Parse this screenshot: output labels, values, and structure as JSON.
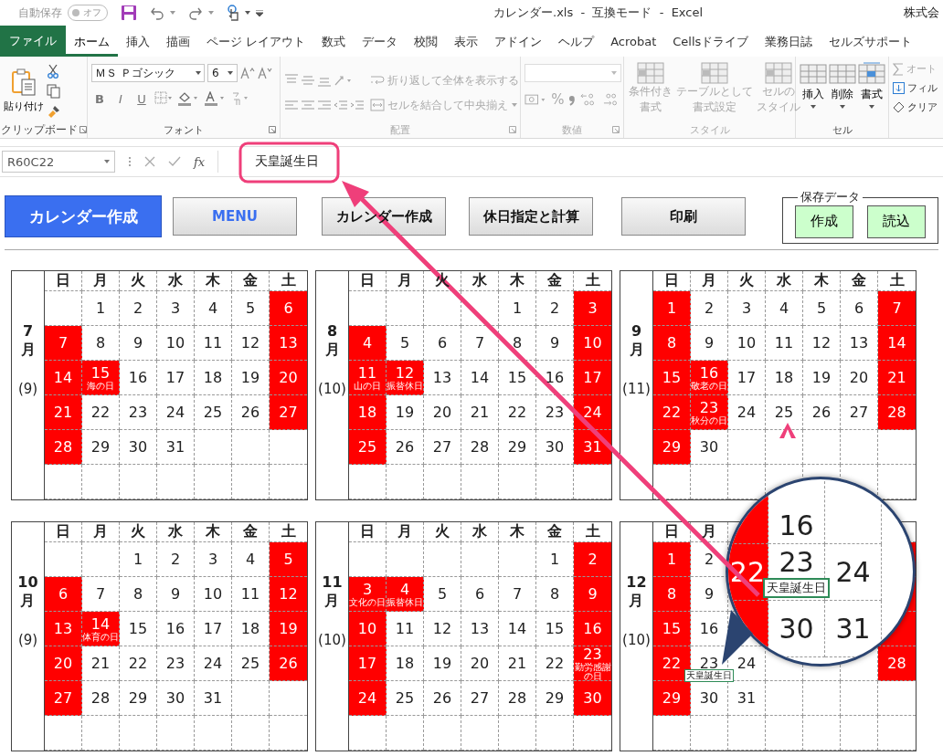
{
  "title_bar": {
    "autosave_label": "自動保存",
    "autosave_state": "オフ",
    "autosave_on": false,
    "title": "カレンダー.xls  -  互換モード  -  Excel",
    "account": "株式会"
  },
  "file_tab": "ファイル",
  "tabs": [
    {
      "label": "ホーム",
      "selected": true
    },
    {
      "label": "挿入",
      "selected": false
    },
    {
      "label": "描画",
      "selected": false
    },
    {
      "label": "ページ レイアウト",
      "selected": false
    },
    {
      "label": "数式",
      "selected": false
    },
    {
      "label": "データ",
      "selected": false
    },
    {
      "label": "校閲",
      "selected": false
    },
    {
      "label": "表示",
      "selected": false
    },
    {
      "label": "アドイン",
      "selected": false
    },
    {
      "label": "ヘルプ",
      "selected": false
    },
    {
      "label": "Acrobat",
      "selected": false
    },
    {
      "label": "Cellsドライブ",
      "selected": false
    },
    {
      "label": "業務日誌",
      "selected": false
    },
    {
      "label": "セルズサポート",
      "selected": false
    }
  ],
  "ribbon": {
    "clipboard": {
      "paste": "貼り付け",
      "label": "クリップボード"
    },
    "font": {
      "name": "ＭＳ Ｐゴシック",
      "size": "6",
      "styles": [
        "B",
        "I",
        "U"
      ],
      "label": "フォント"
    },
    "alignment": {
      "wrap": "折り返して全体を表示する",
      "merge": "セルを結合して中央揃え",
      "label": "配置",
      "disabled": true
    },
    "number": {
      "percent": "%",
      "label": "数値",
      "disabled": true
    },
    "styles": {
      "buttons": [
        {
          "lines": [
            "条件付き",
            "書式"
          ]
        },
        {
          "lines": [
            "テーブルとして",
            "書式設定"
          ]
        },
        {
          "lines": [
            "セルの",
            "スタイル"
          ]
        }
      ],
      "label": "スタイル",
      "disabled": true
    },
    "cells": {
      "buttons": [
        "挿入",
        "削除",
        "書式"
      ],
      "label": "セル"
    },
    "editing": {
      "items": [
        "オート",
        "フィル",
        "クリア"
      ]
    }
  },
  "formula_bar": {
    "name_box": "R60C22",
    "fx": "fx",
    "value": "天皇誕生日"
  },
  "buttons": [
    {
      "label": "カレンダー作成",
      "kind": "primary"
    },
    {
      "label": "MENU",
      "kind": "menu"
    },
    {
      "label": "カレンダー作成",
      "kind": "plain"
    },
    {
      "label": "休日指定と計算",
      "kind": "plain"
    },
    {
      "label": "印刷",
      "kind": "plain"
    }
  ],
  "saved_data": {
    "title": "保存データ",
    "buttons": [
      "作成",
      "読込"
    ]
  },
  "calendars": [
    {
      "month": "7",
      "unit": "月",
      "count": "(9)",
      "weekdays": [
        "日",
        "月",
        "火",
        "水",
        "木",
        "金",
        "土"
      ],
      "weeks": [
        [
          {
            "red": false
          },
          {
            "day": "1",
            "red": false
          },
          {
            "day": "2",
            "red": false
          },
          {
            "day": "3",
            "red": false
          },
          {
            "day": "4",
            "red": false
          },
          {
            "day": "5",
            "red": false
          },
          {
            "day": "6",
            "red": true
          }
        ],
        [
          {
            "day": "7",
            "red": true
          },
          {
            "day": "8",
            "red": false
          },
          {
            "day": "9",
            "red": false
          },
          {
            "day": "10",
            "red": false
          },
          {
            "day": "11",
            "red": false
          },
          {
            "day": "12",
            "red": false
          },
          {
            "day": "13",
            "red": true
          }
        ],
        [
          {
            "day": "14",
            "red": true
          },
          {
            "day": "15",
            "red": true,
            "label": "海の日"
          },
          {
            "day": "16",
            "red": false
          },
          {
            "day": "17",
            "red": false
          },
          {
            "day": "18",
            "red": false
          },
          {
            "day": "19",
            "red": false
          },
          {
            "day": "20",
            "red": true
          }
        ],
        [
          {
            "day": "21",
            "red": true
          },
          {
            "day": "22",
            "red": false
          },
          {
            "day": "23",
            "red": false
          },
          {
            "day": "24",
            "red": false
          },
          {
            "day": "25",
            "red": false
          },
          {
            "day": "26",
            "red": false
          },
          {
            "day": "27",
            "red": true
          }
        ],
        [
          {
            "day": "28",
            "red": true
          },
          {
            "day": "29",
            "red": false
          },
          {
            "day": "30",
            "red": false
          },
          {
            "day": "31",
            "red": false
          },
          {
            "red": false
          },
          {
            "red": false
          },
          {
            "red": false
          }
        ]
      ]
    },
    {
      "month": "8",
      "unit": "月",
      "count": "(10)",
      "weekdays": [
        "日",
        "月",
        "火",
        "水",
        "木",
        "金",
        "土"
      ],
      "weeks": [
        [
          {
            "red": false
          },
          {
            "red": false
          },
          {
            "red": false
          },
          {
            "red": false
          },
          {
            "day": "1",
            "red": false
          },
          {
            "day": "2",
            "red": false
          },
          {
            "day": "3",
            "red": true
          }
        ],
        [
          {
            "day": "4",
            "red": true
          },
          {
            "day": "5",
            "red": false
          },
          {
            "day": "6",
            "red": false
          },
          {
            "day": "7",
            "red": false
          },
          {
            "day": "8",
            "red": false
          },
          {
            "day": "9",
            "red": false
          },
          {
            "day": "10",
            "red": true
          }
        ],
        [
          {
            "day": "11",
            "red": true,
            "label": "山の日"
          },
          {
            "day": "12",
            "red": true,
            "label": "振替休日"
          },
          {
            "day": "13",
            "red": false
          },
          {
            "day": "14",
            "red": false
          },
          {
            "day": "15",
            "red": false
          },
          {
            "day": "16",
            "red": false
          },
          {
            "day": "17",
            "red": true
          }
        ],
        [
          {
            "day": "18",
            "red": true
          },
          {
            "day": "19",
            "red": false
          },
          {
            "day": "20",
            "red": false
          },
          {
            "day": "21",
            "red": false
          },
          {
            "day": "22",
            "red": false
          },
          {
            "day": "23",
            "red": false
          },
          {
            "day": "24",
            "red": true
          }
        ],
        [
          {
            "day": "25",
            "red": true
          },
          {
            "day": "26",
            "red": false
          },
          {
            "day": "27",
            "red": false
          },
          {
            "day": "28",
            "red": false
          },
          {
            "day": "29",
            "red": false
          },
          {
            "day": "30",
            "red": false
          },
          {
            "day": "31",
            "red": true
          }
        ]
      ]
    },
    {
      "month": "9",
      "unit": "月",
      "count": "(11)",
      "weekdays": [
        "日",
        "月",
        "火",
        "水",
        "木",
        "金",
        "土"
      ],
      "weeks": [
        [
          {
            "day": "1",
            "red": true
          },
          {
            "day": "2",
            "red": false
          },
          {
            "day": "3",
            "red": false
          },
          {
            "day": "4",
            "red": false
          },
          {
            "day": "5",
            "red": false
          },
          {
            "day": "6",
            "red": false
          },
          {
            "day": "7",
            "red": true
          }
        ],
        [
          {
            "day": "8",
            "red": true
          },
          {
            "day": "9",
            "red": false
          },
          {
            "day": "10",
            "red": false
          },
          {
            "day": "11",
            "red": false
          },
          {
            "day": "12",
            "red": false
          },
          {
            "day": "13",
            "red": false
          },
          {
            "day": "14",
            "red": true
          }
        ],
        [
          {
            "day": "15",
            "red": true
          },
          {
            "day": "16",
            "red": true,
            "label": "敬老の日"
          },
          {
            "day": "17",
            "red": false
          },
          {
            "day": "18",
            "red": false
          },
          {
            "day": "19",
            "red": false
          },
          {
            "day": "20",
            "red": false
          },
          {
            "day": "21",
            "red": true
          }
        ],
        [
          {
            "day": "22",
            "red": true
          },
          {
            "day": "23",
            "red": true,
            "label": "秋分の日"
          },
          {
            "day": "24",
            "red": false
          },
          {
            "day": "25",
            "red": false
          },
          {
            "day": "26",
            "red": false
          },
          {
            "day": "27",
            "red": false
          },
          {
            "day": "28",
            "red": true
          }
        ],
        [
          {
            "day": "29",
            "red": true
          },
          {
            "day": "30",
            "red": false
          },
          {
            "red": false
          },
          {
            "red": false
          },
          {
            "red": false
          },
          {
            "red": false
          },
          {
            "red": false
          }
        ]
      ]
    },
    {
      "month": "10",
      "unit": "月",
      "count": "(9)",
      "weekdays": [
        "日",
        "月",
        "火",
        "水",
        "木",
        "金",
        "土"
      ],
      "weeks": [
        [
          {
            "red": false
          },
          {
            "red": false
          },
          {
            "day": "1",
            "red": false
          },
          {
            "day": "2",
            "red": false
          },
          {
            "day": "3",
            "red": false
          },
          {
            "day": "4",
            "red": false
          },
          {
            "day": "5",
            "red": true
          }
        ],
        [
          {
            "day": "6",
            "red": true
          },
          {
            "day": "7",
            "red": false
          },
          {
            "day": "8",
            "red": false
          },
          {
            "day": "9",
            "red": false
          },
          {
            "day": "10",
            "red": false
          },
          {
            "day": "11",
            "red": false
          },
          {
            "day": "12",
            "red": true
          }
        ],
        [
          {
            "day": "13",
            "red": true
          },
          {
            "day": "14",
            "red": true,
            "label": "体育の日"
          },
          {
            "day": "15",
            "red": false
          },
          {
            "day": "16",
            "red": false
          },
          {
            "day": "17",
            "red": false
          },
          {
            "day": "18",
            "red": false
          },
          {
            "day": "19",
            "red": true
          }
        ],
        [
          {
            "day": "20",
            "red": true
          },
          {
            "day": "21",
            "red": false
          },
          {
            "day": "22",
            "red": false
          },
          {
            "day": "23",
            "red": false
          },
          {
            "day": "24",
            "red": false
          },
          {
            "day": "25",
            "red": false
          },
          {
            "day": "26",
            "red": true
          }
        ],
        [
          {
            "day": "27",
            "red": true
          },
          {
            "day": "28",
            "red": false
          },
          {
            "day": "29",
            "red": false
          },
          {
            "day": "30",
            "red": false
          },
          {
            "day": "31",
            "red": false
          },
          {
            "red": false
          },
          {
            "red": false
          }
        ]
      ]
    },
    {
      "month": "11",
      "unit": "月",
      "count": "(10)",
      "weekdays": [
        "日",
        "月",
        "火",
        "水",
        "木",
        "金",
        "土"
      ],
      "weeks": [
        [
          {
            "red": false
          },
          {
            "red": false
          },
          {
            "red": false
          },
          {
            "red": false
          },
          {
            "red": false
          },
          {
            "day": "1",
            "red": false
          },
          {
            "day": "2",
            "red": true
          }
        ],
        [
          {
            "day": "3",
            "red": true,
            "label": "文化の日"
          },
          {
            "day": "4",
            "red": true,
            "label": "振替休日"
          },
          {
            "day": "5",
            "red": false
          },
          {
            "day": "6",
            "red": false
          },
          {
            "day": "7",
            "red": false
          },
          {
            "day": "8",
            "red": false
          },
          {
            "day": "9",
            "red": true
          }
        ],
        [
          {
            "day": "10",
            "red": true
          },
          {
            "day": "11",
            "red": false
          },
          {
            "day": "12",
            "red": false
          },
          {
            "day": "13",
            "red": false
          },
          {
            "day": "14",
            "red": false
          },
          {
            "day": "15",
            "red": false
          },
          {
            "day": "16",
            "red": true
          }
        ],
        [
          {
            "day": "17",
            "red": true
          },
          {
            "day": "18",
            "red": false
          },
          {
            "day": "19",
            "red": false
          },
          {
            "day": "20",
            "red": false
          },
          {
            "day": "21",
            "red": false
          },
          {
            "day": "22",
            "red": false
          },
          {
            "day": "23",
            "red": true,
            "label": "勤労感謝の日"
          }
        ],
        [
          {
            "day": "24",
            "red": true
          },
          {
            "day": "25",
            "red": false
          },
          {
            "day": "26",
            "red": false
          },
          {
            "day": "27",
            "red": false
          },
          {
            "day": "28",
            "red": false
          },
          {
            "day": "29",
            "red": false
          },
          {
            "day": "30",
            "red": true
          }
        ]
      ]
    },
    {
      "month": "12",
      "unit": "月",
      "count": "(10)",
      "weekdays": [
        "日",
        "月"
      ],
      "weeks": [
        {
          "cells": [
            {
              "day": "1",
              "red": true
            },
            {
              "day": "2",
              "red": false
            }
          ],
          "end": {
            "red": true
          }
        },
        {
          "cells": [
            {
              "day": "8",
              "red": true
            },
            {
              "day": "9",
              "red": false
            }
          ],
          "end": {
            "red": true
          }
        },
        {
          "cells": [
            {
              "day": "15",
              "red": true
            },
            {
              "day": "16",
              "red": false
            }
          ],
          "end": {
            "red": true
          }
        },
        {
          "cells": [
            {
              "day": "22",
              "red": true
            },
            {
              "day": "23",
              "red": false,
              "label": "天皇誕生日"
            },
            {
              "day": "24",
              "red": false
            }
          ],
          "end": {
            "day": "28",
            "red": true
          }
        },
        [
          {
            "day": "29",
            "red": true
          },
          {
            "day": "30",
            "red": false
          },
          {
            "day": "31",
            "red": false
          },
          {
            "red": false
          },
          {
            "red": false
          },
          {
            "red": false
          },
          {
            "red": false
          }
        ]
      ]
    }
  ],
  "magnifier": {
    "rows": [
      [
        {
          "red": true
        },
        {
          "day": "16",
          "red": false
        },
        {
          "red": false
        }
      ],
      [
        {
          "day": "22",
          "red": true
        },
        {
          "day": "23",
          "red": false,
          "label": "天皇誕生日"
        },
        {
          "day": "24",
          "red": false
        }
      ],
      [
        {
          "red": true
        },
        {
          "day": "30",
          "red": false
        },
        {
          "day": "31",
          "red": false
        }
      ]
    ]
  }
}
